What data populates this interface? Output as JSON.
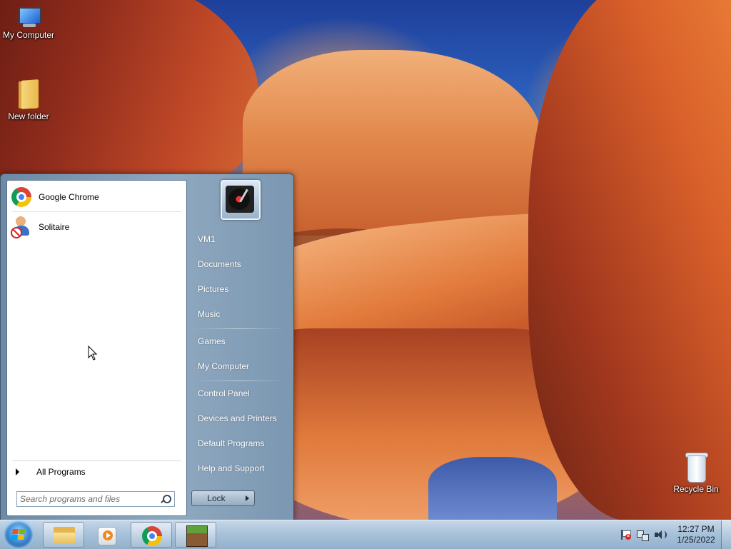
{
  "desktop": {
    "icons": [
      {
        "label": "My Computer",
        "icon": "computer-icon"
      },
      {
        "label": "New folder",
        "icon": "folder-icon"
      },
      {
        "label": "Recycle Bin",
        "icon": "recycle-bin-icon"
      }
    ]
  },
  "start_menu": {
    "pinned_programs": [
      {
        "label": "Google Chrome",
        "icon": "chrome-icon"
      },
      {
        "label": "Solitaire",
        "icon": "solitaire-icon"
      }
    ],
    "all_programs_label": "All Programs",
    "search": {
      "placeholder": "Search programs and files",
      "value": ""
    },
    "user": {
      "icon": "user-picture-turntable-icon"
    },
    "right_links": [
      {
        "label": "VM1"
      },
      {
        "label": "Documents"
      },
      {
        "label": "Pictures"
      },
      {
        "label": "Music"
      },
      {
        "label": "Games"
      },
      {
        "label": "My Computer"
      },
      {
        "label": "Control Panel"
      },
      {
        "label": "Devices and Printers"
      },
      {
        "label": "Default Programs"
      },
      {
        "label": "Help and Support"
      }
    ],
    "shutdown_button_label": "Lock"
  },
  "taskbar": {
    "start_button_icon": "windows-logo-icon",
    "pinned": [
      {
        "icon": "windows-explorer-icon"
      },
      {
        "icon": "media-player-icon"
      },
      {
        "icon": "chrome-icon"
      },
      {
        "icon": "minecraft-icon"
      }
    ],
    "tray": {
      "icons": [
        "action-center-flag-icon",
        "network-icon",
        "volume-icon"
      ],
      "time": "12:27 PM",
      "date": "1/25/2022"
    }
  },
  "colors": {
    "taskbar": "#a9c2da",
    "start_menu_right": "#8ea8bf",
    "programs_pane": "#ffffff"
  }
}
